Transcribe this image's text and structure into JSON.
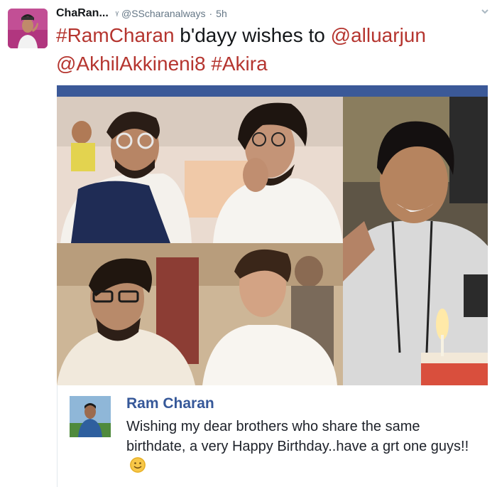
{
  "tweet": {
    "display_name": "ChaRan...",
    "verified_glyph": "ᵞ",
    "handle": "@SScharanalways",
    "separator": "·",
    "time": "5h",
    "text_parts": [
      {
        "text": "#RamCharan",
        "type": "hashtag"
      },
      {
        "text": " b'dayy wishes to ",
        "type": "plain"
      },
      {
        "text": "@alluarjun",
        "type": "mention"
      },
      {
        "text": " ",
        "type": "plain"
      },
      {
        "text": "@AkhilAkkineni8",
        "type": "mention"
      },
      {
        "text": " ",
        "type": "plain"
      },
      {
        "text": "#Akira",
        "type": "hashtag"
      }
    ],
    "link_color": "#b5352f",
    "menu_icon": "chevron-down-icon"
  },
  "facebook_post": {
    "author": "Ram Charan",
    "message": "Wishing my dear brothers who share the same birthdate, a very Happy Birthday..have a grt one guys!!",
    "emoji": "smiley-emoji",
    "author_color": "#365899",
    "bar_color": "#3b5998"
  }
}
